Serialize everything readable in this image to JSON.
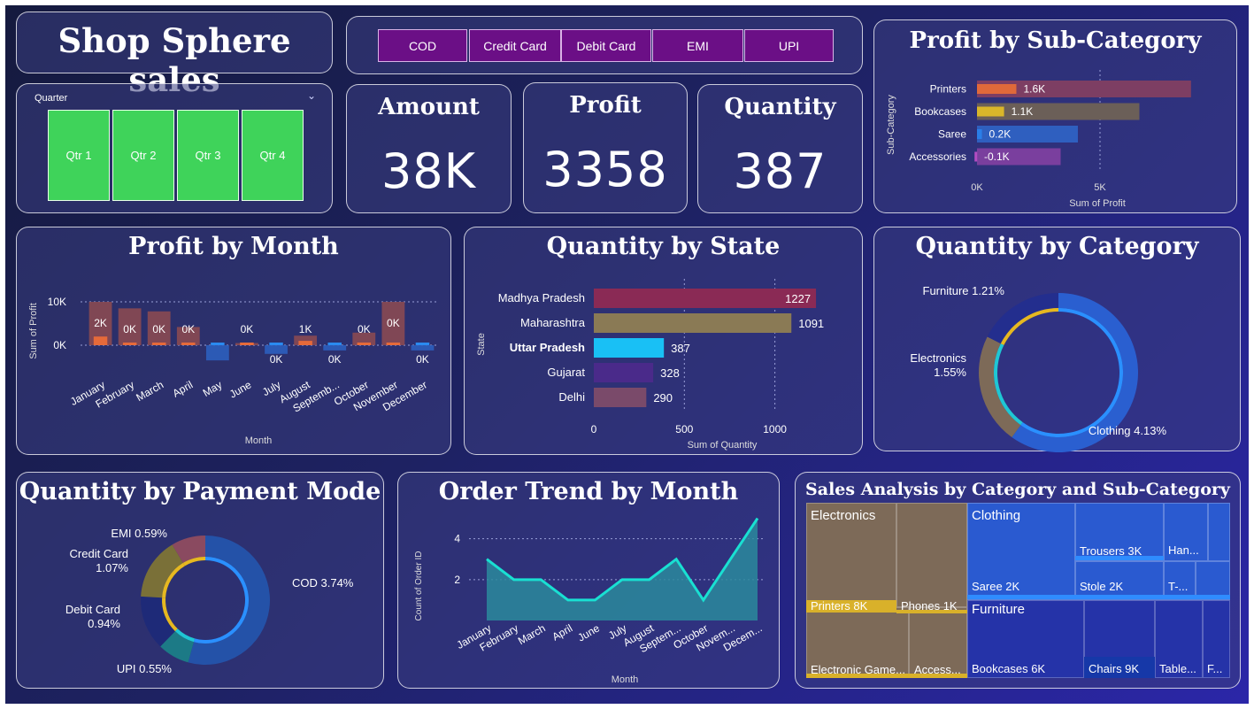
{
  "title": "Shop Sphere sales",
  "payment_buttons": [
    "COD",
    "Credit Card",
    "Debit Card",
    "EMI",
    "UPI"
  ],
  "quarter_slicer": {
    "label": "Quarter",
    "tiles": [
      "Qtr 1",
      "Qtr 2",
      "Qtr 3",
      "Qtr 4"
    ]
  },
  "kpis": {
    "amount": {
      "label": "Amount",
      "value": "38K"
    },
    "profit": {
      "label": "Profit",
      "value": "3358"
    },
    "quantity": {
      "label": "Quantity",
      "value": "387"
    }
  },
  "colors": {
    "slicer_tile": "#3fd35a",
    "payment_button": "#6b0f86",
    "highlight": "#1aa7ff"
  },
  "chart_data": [
    {
      "id": "profit_by_subcategory",
      "type": "bar",
      "title": "Profit by Sub-Category",
      "xlabel": "Sum of Profit",
      "ylabel": "Sub-Category",
      "categories": [
        "Printers",
        "Bookcases",
        "Saree",
        "Accessories"
      ],
      "values": [
        1600,
        1100,
        200,
        -100
      ],
      "data_labels": [
        "1.6K",
        "1.1K",
        "0.2K",
        "-0.1K"
      ],
      "background_values": [
        8700,
        6600,
        4100,
        3400
      ],
      "x_ticks": [
        "0K",
        "5K"
      ],
      "xlim": [
        0,
        10000
      ],
      "colors": [
        "#e0693a",
        "#d9b62a",
        "#2a7ee8",
        "#b34cc2"
      ],
      "background_colors": [
        "#7d3e63",
        "#6b5f58",
        "#2f5fbf",
        "#7a3f9e"
      ]
    },
    {
      "id": "profit_by_month",
      "type": "bar",
      "title": "Profit by Month",
      "xlabel": "Month",
      "ylabel": "Sum of Profit",
      "categories": [
        "January",
        "February",
        "March",
        "April",
        "May",
        "June",
        "July",
        "August",
        "Septemb...",
        "October",
        "November",
        "December"
      ],
      "values": [
        2000,
        0,
        0,
        0,
        0,
        0,
        0,
        1000,
        0,
        0,
        0,
        0
      ],
      "data_labels": [
        "2K",
        "0K",
        "0K",
        "0K",
        "",
        "0K",
        "0K",
        "1K",
        "0K",
        "0K",
        "0K",
        "0K"
      ],
      "background_values": [
        10000,
        8500,
        7800,
        4200,
        -3500,
        500,
        -2000,
        2200,
        -1200,
        2900,
        10000,
        -1200
      ],
      "y_ticks": [
        "10K",
        "0K"
      ],
      "ylim": [
        -5000,
        12000
      ]
    },
    {
      "id": "quantity_by_state",
      "type": "bar",
      "title": "Quantity by State",
      "xlabel": "Sum of Quantity",
      "ylabel": "State",
      "categories": [
        "Madhya Pradesh",
        "Maharashtra",
        "Uttar Pradesh",
        "Gujarat",
        "Delhi"
      ],
      "values": [
        1227,
        1091,
        387,
        328,
        290
      ],
      "highlighted": "Uttar Pradesh",
      "x_ticks": [
        0,
        500,
        1000
      ],
      "xlim": [
        0,
        1300
      ],
      "colors": [
        "#8a2a55",
        "#8a7a55",
        "#19c0f5",
        "#4a2a8a",
        "#7a4a6a"
      ]
    },
    {
      "id": "quantity_by_category",
      "type": "pie",
      "donut": true,
      "title": "Quantity by Category",
      "labels": [
        "Clothing",
        "Electronics",
        "Furniture"
      ],
      "values": [
        4.13,
        1.55,
        1.21
      ],
      "data_labels": [
        "Clothing 4.13%",
        "Electronics 1.55%",
        "Furniture 1.21%"
      ],
      "colors": [
        "#2a5fd0",
        "#7d6a58",
        "#232e8e"
      ]
    },
    {
      "id": "quantity_by_payment_mode",
      "type": "pie",
      "donut": true,
      "title": "Quantity by Payment Mode",
      "labels": [
        "COD",
        "UPI",
        "Debit Card",
        "Credit Card",
        "EMI"
      ],
      "values": [
        3.74,
        0.55,
        0.94,
        1.07,
        0.59
      ],
      "data_labels": [
        "COD 3.74%",
        "UPI 0.55%",
        "Debit Card 0.94%",
        "Credit Card 1.07%",
        "EMI 0.59%"
      ],
      "colors": [
        "#2452a8",
        "#1c7a86",
        "#1e2a78",
        "#7a7038",
        "#8a4a60"
      ]
    },
    {
      "id": "order_trend_by_month",
      "type": "area",
      "title": "Order Trend by Month",
      "xlabel": "Month",
      "ylabel": "Count of Order ID",
      "categories": [
        "January",
        "February",
        "March",
        "April",
        "June",
        "July",
        "August",
        "Septem...",
        "October",
        "Novem...",
        "Decem..."
      ],
      "values": [
        3,
        2,
        2,
        1,
        1,
        2,
        2,
        3,
        1,
        3,
        5
      ],
      "y_ticks": [
        2,
        4
      ],
      "ylim": [
        0,
        5.5
      ]
    },
    {
      "id": "sales_treemap",
      "type": "table",
      "title": "Sales Analysis by Category and Sub-Category",
      "groups": [
        {
          "name": "Electronics",
          "items": [
            {
              "label": "Printers 8K",
              "value": 8000
            },
            {
              "label": "Phones 1K",
              "value": 1000
            },
            {
              "label": "Electronic Game...",
              "value": 0
            },
            {
              "label": "Access...",
              "value": 0
            }
          ]
        },
        {
          "name": "Clothing",
          "items": [
            {
              "label": "Trousers 3K",
              "value": 3000
            },
            {
              "label": "Han...",
              "value": 0
            },
            {
              "label": "Saree 2K",
              "value": 2000
            },
            {
              "label": "Stole 2K",
              "value": 2000
            },
            {
              "label": "T-...",
              "value": 0
            }
          ]
        },
        {
          "name": "Furniture",
          "items": [
            {
              "label": "Bookcases 6K",
              "value": 6000
            },
            {
              "label": "Chairs 9K",
              "value": 9000
            },
            {
              "label": "Table...",
              "value": 0
            },
            {
              "label": "F...",
              "value": 0
            }
          ]
        }
      ]
    }
  ]
}
